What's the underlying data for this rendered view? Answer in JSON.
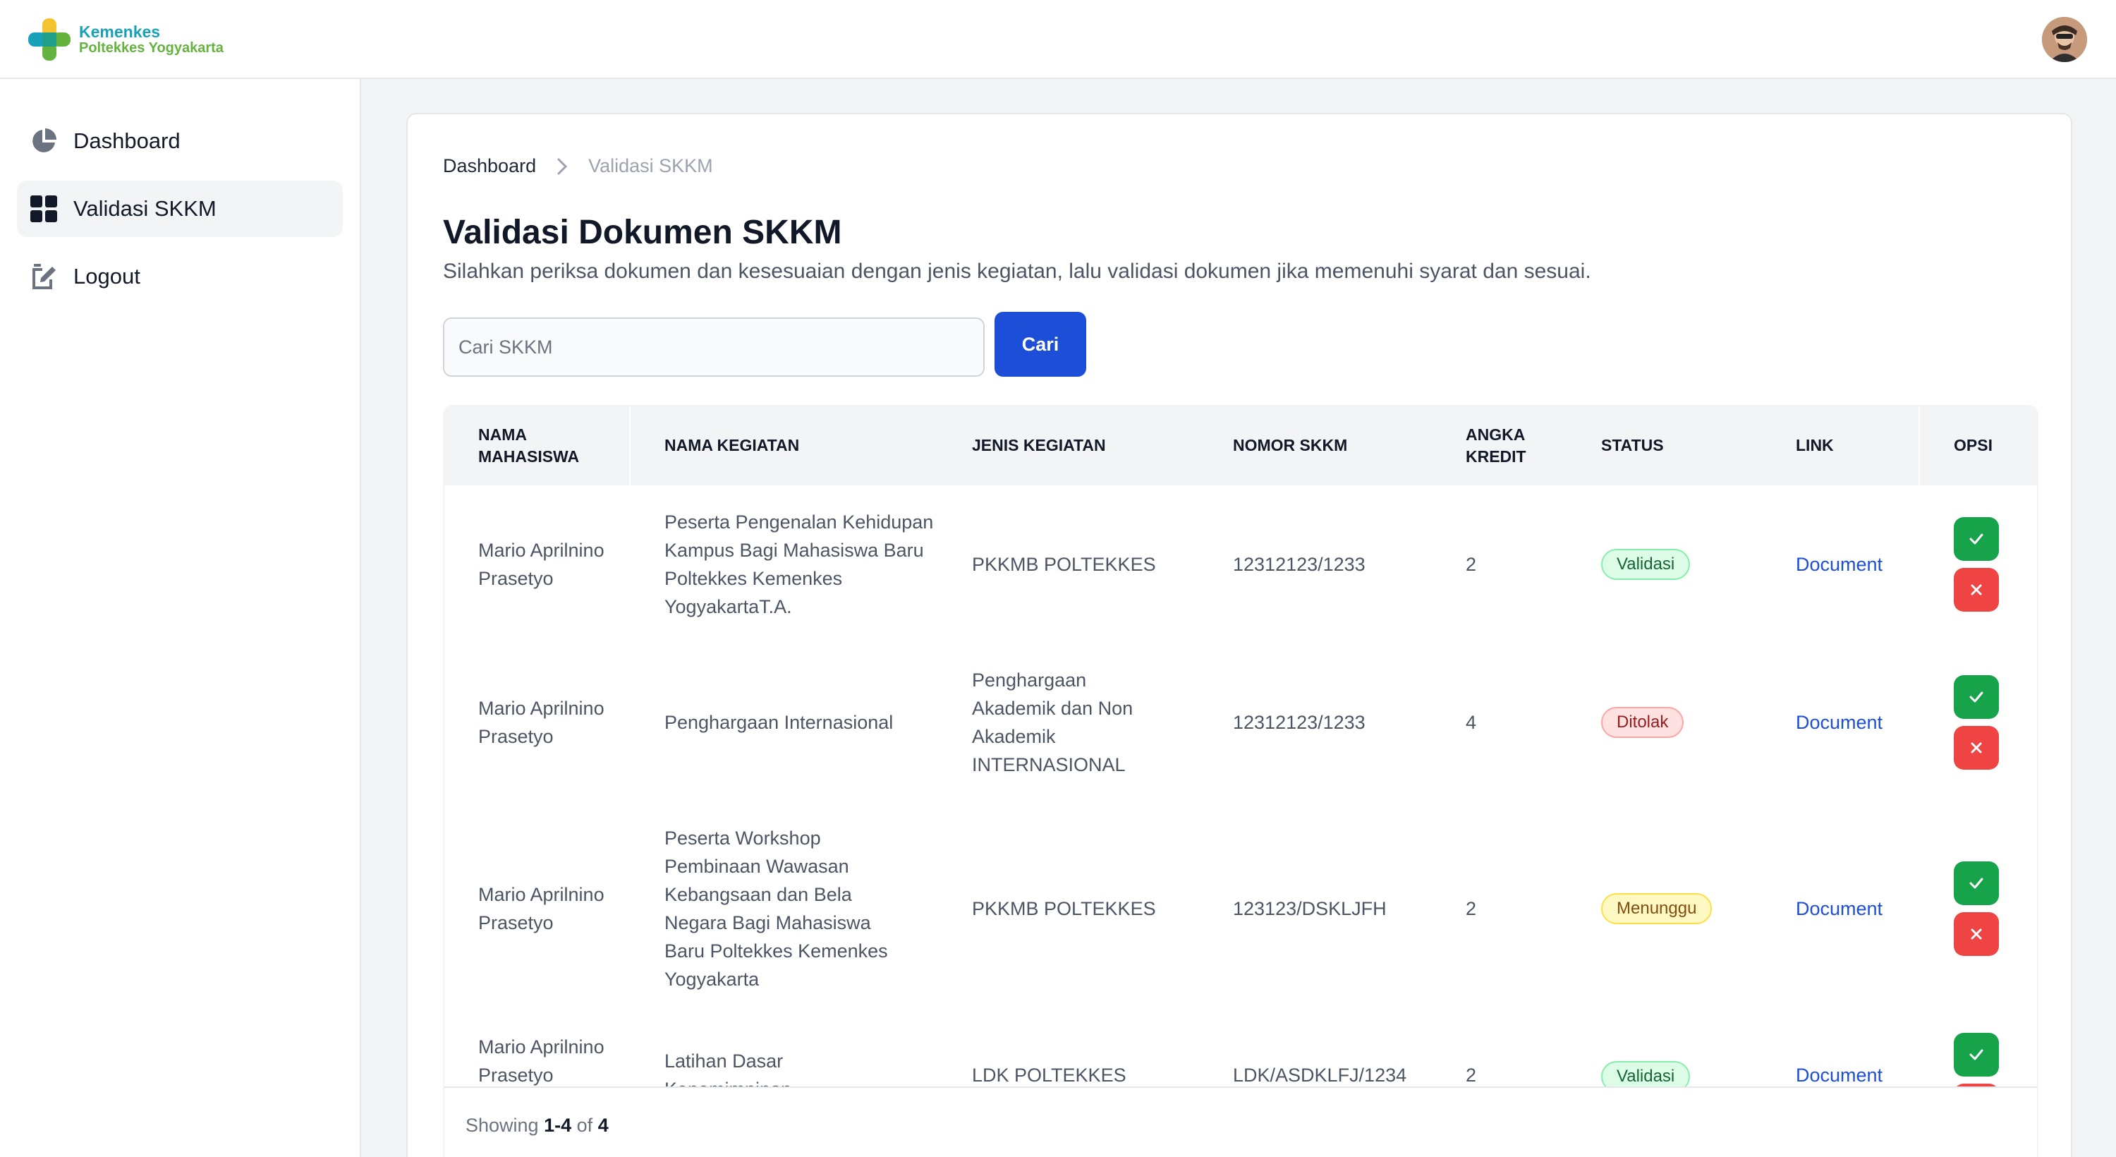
{
  "brand": {
    "title": "Kemenkes",
    "subtitle": "Poltekkes Yogyakarta"
  },
  "sidebar": {
    "items": [
      {
        "label": "Dashboard",
        "icon": "pie-chart-icon",
        "active": false
      },
      {
        "label": "Validasi SKKM",
        "icon": "grid-icon",
        "active": true
      },
      {
        "label": "Logout",
        "icon": "edit-icon",
        "active": false
      }
    ]
  },
  "breadcrumb": {
    "home": "Dashboard",
    "current": "Validasi SKKM"
  },
  "page": {
    "title": "Validasi Dokumen SKKM",
    "description": "Silahkan periksa dokumen dan kesesuaian dengan jenis kegiatan, lalu validasi dokumen jika memenuhi syarat dan sesuai."
  },
  "search": {
    "placeholder": "Cari SKKM",
    "value": "",
    "button_label": "Cari"
  },
  "table": {
    "headers": {
      "nama_mahasiswa_1": "NAMA",
      "nama_mahasiswa_2": "MAHASISWA",
      "nama_kegiatan": "NAMA KEGIATAN",
      "jenis_kegiatan": "JENIS KEGIATAN",
      "nomor_skkm": "NOMOR SKKM",
      "angka_kredit_1": "ANGKA",
      "angka_kredit_2": "KREDIT",
      "status": "STATUS",
      "link": "LINK",
      "opsi": "OPSI"
    },
    "rows": [
      {
        "nama": "Mario Aprilnino Prasetyo",
        "kegiatan": "Peserta Pengenalan Kehidupan Kampus Bagi Mahasiswa Baru Poltekkes Kemenkes YogyakartaT.A.",
        "jenis": "PKKMB POLTEKKES",
        "nomor": "12312123/1233",
        "kredit": "2",
        "status": "Validasi",
        "link": "Document"
      },
      {
        "nama": "Mario Aprilnino Prasetyo",
        "kegiatan": "Penghargaan Internasional",
        "jenis": "Penghargaan Akademik dan Non Akademik INTERNASIONAL",
        "nomor": "12312123/1233",
        "kredit": "4",
        "status": "Ditolak",
        "link": "Document"
      },
      {
        "nama": "Mario Aprilnino Prasetyo",
        "kegiatan": "Peserta Workshop Pembinaan Wawasan Kebangsaan dan Bela Negara Bagi Mahasiswa Baru Poltekkes Kemenkes Yogyakarta",
        "jenis": "PKKMB POLTEKKES",
        "nomor": "123123/DSKLJFH",
        "kredit": "2",
        "status": "Menunggu",
        "link": "Document"
      },
      {
        "nama": "Mario Aprilnino Prasetyo",
        "kegiatan": "Latihan Dasar Kepemimpinan",
        "jenis": "LDK POLTEKKES",
        "nomor": "LDK/ASDKLFJ/1234",
        "kredit": "2",
        "status": "Validasi",
        "link": "Document"
      }
    ]
  },
  "pagination": {
    "prefix": "Showing",
    "range": "1-4",
    "of": "of",
    "total": "4"
  },
  "colors": {
    "primary": "#1d4ed8",
    "success": "#16a34a",
    "danger": "#ef4444",
    "warning_bg": "#fef9c3"
  }
}
